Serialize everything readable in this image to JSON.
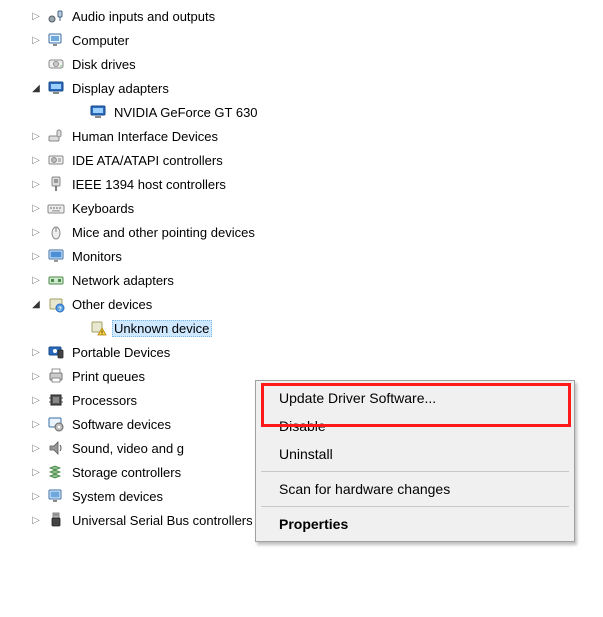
{
  "tree": [
    {
      "id": "audio",
      "level": 0,
      "expander": "closed",
      "icon": "audio-icon",
      "label": "Audio inputs and outputs"
    },
    {
      "id": "computer",
      "level": 0,
      "expander": "closed",
      "icon": "computer-icon",
      "label": "Computer"
    },
    {
      "id": "disk",
      "level": 0,
      "expander": "none",
      "icon": "disk-icon",
      "label": "Disk drives"
    },
    {
      "id": "display",
      "level": 0,
      "expander": "open",
      "icon": "display-icon",
      "label": "Display adapters"
    },
    {
      "id": "gpu",
      "level": 1,
      "expander": "none",
      "icon": "display-icon",
      "label": "NVIDIA GeForce GT 630"
    },
    {
      "id": "hid",
      "level": 0,
      "expander": "closed",
      "icon": "hid-icon",
      "label": "Human Interface Devices"
    },
    {
      "id": "ide",
      "level": 0,
      "expander": "closed",
      "icon": "ide-icon",
      "label": "IDE ATA/ATAPI controllers"
    },
    {
      "id": "ieee1394",
      "level": 0,
      "expander": "closed",
      "icon": "ieee1394-icon",
      "label": "IEEE 1394 host controllers"
    },
    {
      "id": "keyboards",
      "level": 0,
      "expander": "closed",
      "icon": "keyboard-icon",
      "label": "Keyboards"
    },
    {
      "id": "mice",
      "level": 0,
      "expander": "closed",
      "icon": "mouse-icon",
      "label": "Mice and other pointing devices"
    },
    {
      "id": "monitors",
      "level": 0,
      "expander": "closed",
      "icon": "monitor-icon",
      "label": "Monitors"
    },
    {
      "id": "network",
      "level": 0,
      "expander": "closed",
      "icon": "network-icon",
      "label": "Network adapters"
    },
    {
      "id": "other",
      "level": 0,
      "expander": "open",
      "icon": "other-icon",
      "label": "Other devices"
    },
    {
      "id": "unknown",
      "level": 1,
      "expander": "none",
      "icon": "unknown-icon",
      "label": "Unknown device",
      "selected": true
    },
    {
      "id": "portable",
      "level": 0,
      "expander": "closed",
      "icon": "portable-icon",
      "label": "Portable Devices"
    },
    {
      "id": "printq",
      "level": 0,
      "expander": "closed",
      "icon": "printer-icon",
      "label": "Print queues"
    },
    {
      "id": "proc",
      "level": 0,
      "expander": "closed",
      "icon": "processor-icon",
      "label": "Processors"
    },
    {
      "id": "swdev",
      "level": 0,
      "expander": "closed",
      "icon": "software-icon",
      "label": "Software devices"
    },
    {
      "id": "sound",
      "level": 0,
      "expander": "closed",
      "icon": "sound-icon",
      "label": "Sound, video and g"
    },
    {
      "id": "storage",
      "level": 0,
      "expander": "closed",
      "icon": "storage-icon",
      "label": "Storage controllers"
    },
    {
      "id": "system",
      "level": 0,
      "expander": "closed",
      "icon": "system-icon",
      "label": "System devices"
    },
    {
      "id": "usb",
      "level": 0,
      "expander": "closed",
      "icon": "usb-icon",
      "label": "Universal Serial Bus controllers"
    }
  ],
  "context_menu": {
    "update": "Update Driver Software...",
    "disable": "Disable",
    "uninstall": "Uninstall",
    "scan": "Scan for hardware changes",
    "properties": "Properties"
  },
  "highlighted_item": "update"
}
